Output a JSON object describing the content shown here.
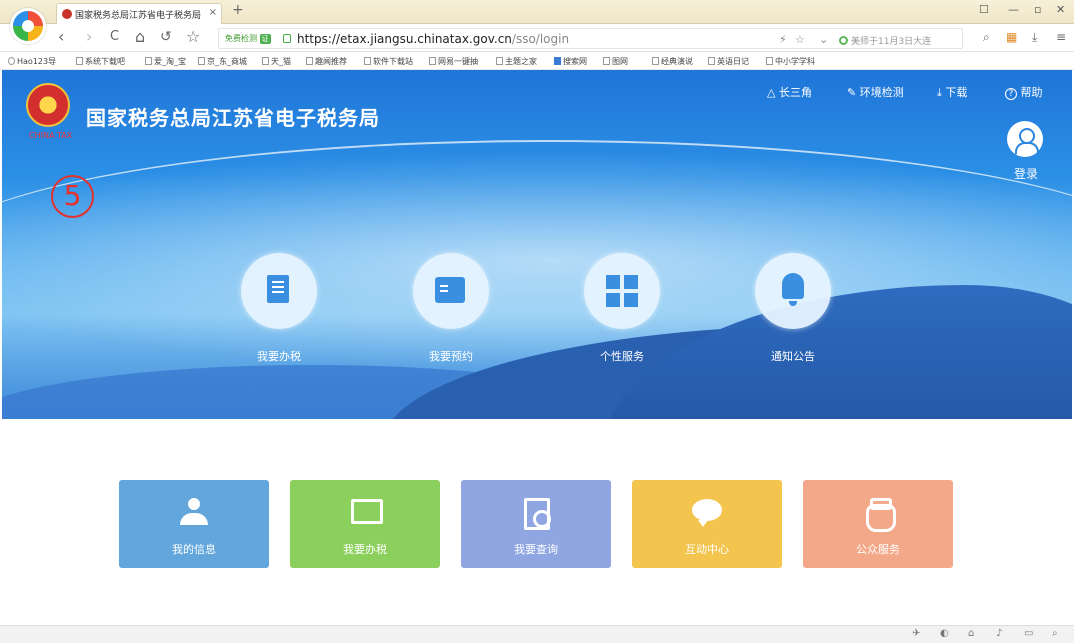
{
  "browser": {
    "tab_title": "国家税务总局江苏省电子税务局",
    "tab_close": "×",
    "new_tab": "+",
    "window_controls": {
      "skin": "☐",
      "minimize": "—",
      "restore": "▫",
      "close": "✕"
    },
    "nav": {
      "back": "‹",
      "forward": "›",
      "refresh": "C",
      "home": "⌂",
      "undo": "↺",
      "favorite": "☆"
    },
    "safe_badge": "免费检测",
    "safe_mark": "证",
    "url_host": "https://etax.jiangsu.chinatax.gov.cn",
    "url_path": "/sso/login",
    "addr_icons": {
      "flash": "⚡",
      "star": "☆",
      "dropdown": "⌄"
    },
    "news_text": "美师于11月3日大连",
    "tools": {
      "search": "⌕",
      "apps": "▦",
      "download": "⤓",
      "menu": "≡"
    }
  },
  "bookmarks": [
    "Hao123导",
    "系统下载吧",
    "爱_淘_宝",
    "京_东_商城",
    "天_猫",
    "趣闻推荐",
    "软件下载站",
    "网易一键抽",
    "主题之家",
    "搜索网",
    "图网",
    "经典演说",
    "英语日记",
    "中小学学科"
  ],
  "hero": {
    "emblem_caption": "CHINA TAX",
    "site_title": "国家税务总局江苏省电子税务局",
    "top_nav": [
      {
        "icon": "△",
        "label": "长三角"
      },
      {
        "icon": "✎",
        "label": "环境检测"
      },
      {
        "icon": "⤓",
        "label": "下载"
      },
      {
        "icon": "?",
        "label": "帮助"
      }
    ],
    "login_label": "登录",
    "annotation_marker": "5",
    "services": [
      {
        "label": "我要办税"
      },
      {
        "label": "我要预约"
      },
      {
        "label": "个性服务"
      },
      {
        "label": "通知公告"
      }
    ]
  },
  "tiles": [
    {
      "label": "我的信息",
      "color": "#62a6dc"
    },
    {
      "label": "我要办税",
      "color": "#8bd05c"
    },
    {
      "label": "我要查询",
      "color": "#8fa6e3"
    },
    {
      "label": "互动中心",
      "color": "#f3c54e"
    },
    {
      "label": "公众服务",
      "color": "#f4a88a"
    }
  ],
  "statusbar": {
    "icons": [
      "✈",
      "◐",
      "⌂",
      "♪",
      "▭",
      "⌕"
    ]
  }
}
